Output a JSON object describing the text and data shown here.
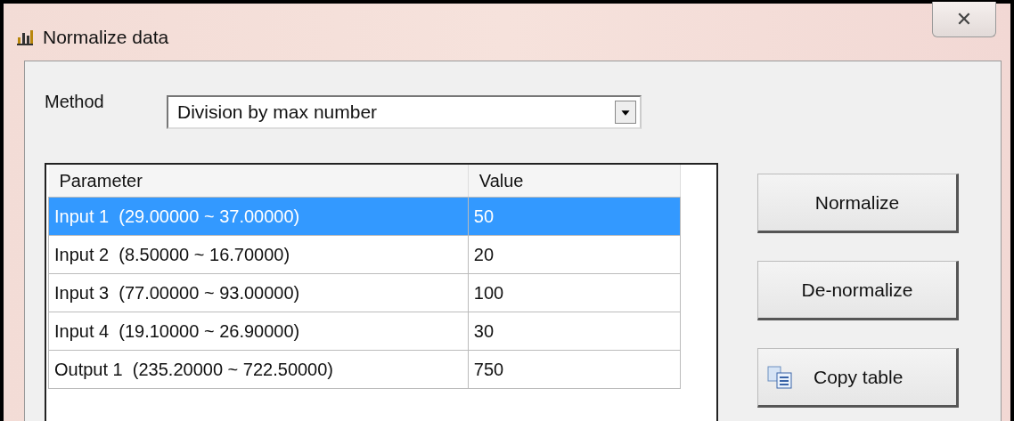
{
  "window": {
    "title": "Normalize data",
    "close": "✕"
  },
  "method": {
    "label": "Method",
    "value": "Division by max number"
  },
  "table": {
    "columns": [
      "Parameter",
      "Value"
    ],
    "rows": [
      {
        "parameter": "Input 1  (29.00000 ~ 37.00000)",
        "value": "50",
        "selected": true
      },
      {
        "parameter": "Input 2  (8.50000 ~ 16.70000)",
        "value": "20",
        "selected": false
      },
      {
        "parameter": "Input 3  (77.00000 ~ 93.00000)",
        "value": "100",
        "selected": false
      },
      {
        "parameter": "Input 4  (19.10000 ~ 26.90000)",
        "value": "30",
        "selected": false
      },
      {
        "parameter": "Output 1  (235.20000 ~ 722.50000)",
        "value": "750",
        "selected": false
      }
    ]
  },
  "buttons": [
    {
      "label": "Normalize",
      "kind": "plain"
    },
    {
      "label": "De-normalize",
      "kind": "plain"
    },
    {
      "label": "Copy table",
      "kind": "copy"
    }
  ]
}
